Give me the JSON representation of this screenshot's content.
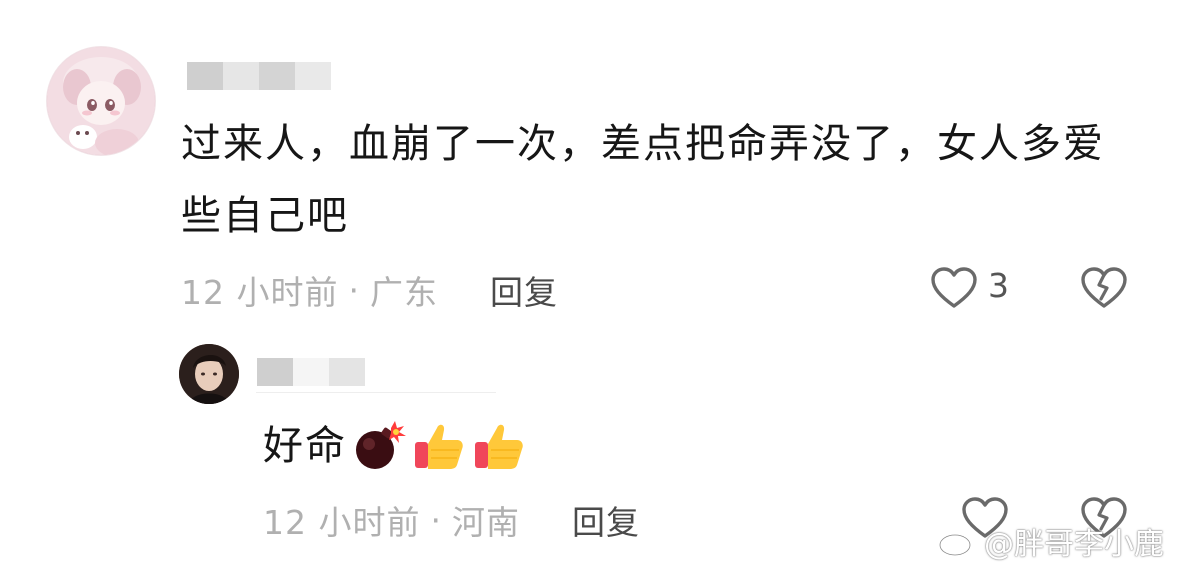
{
  "comment": {
    "text": "过来人，血崩了一次，差点把命弄没了，女人多爱些自己吧",
    "time": "12 小时前",
    "separator": "·",
    "location": "广东",
    "reply_label": "回复",
    "like_count": "3",
    "like_icon": "heart-outline-icon",
    "dislike_icon": "broken-heart-icon"
  },
  "reply": {
    "text": "好命",
    "emojis": [
      "bomb-icon",
      "thumbs-up-icon",
      "thumbs-up-icon"
    ],
    "time": "12 小时前",
    "separator": "·",
    "location": "河南",
    "reply_label": "回复",
    "like_icon": "heart-outline-icon",
    "dislike_icon": "broken-heart-icon"
  },
  "watermark": {
    "text": "@胖哥李小鹿",
    "icon": "weibo-icon"
  },
  "colors": {
    "text": "#161616",
    "meta": "#b0b0b0",
    "icon": "#555555"
  }
}
